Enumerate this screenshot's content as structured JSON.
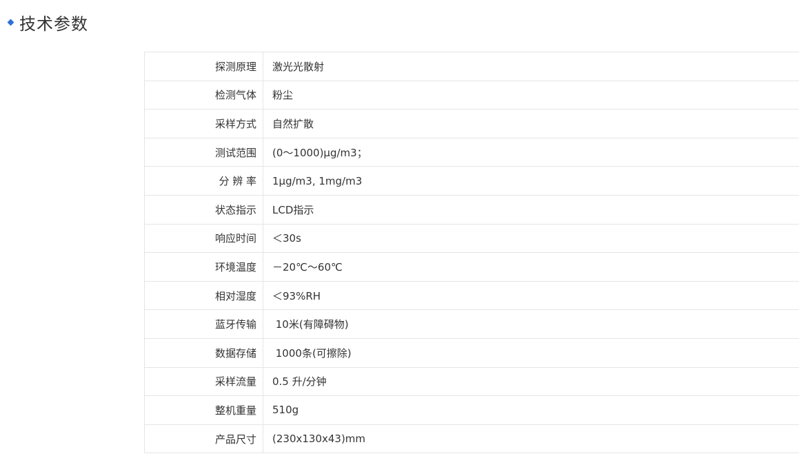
{
  "section": {
    "title": "技术参数"
  },
  "specs": [
    {
      "label": "探测原理",
      "value": "激光光散射"
    },
    {
      "label": "检测气体",
      "value": "粉尘"
    },
    {
      "label": "采样方式",
      "value": "自然扩散"
    },
    {
      "label": "测试范围",
      "value": "(0～1000)μg/m3；"
    },
    {
      "label": "分 辨 率",
      "value": "1μg/m3, 1mg/m3"
    },
    {
      "label": "状态指示",
      "value": "LCD指示"
    },
    {
      "label": "响应时间",
      "value": "＜30s"
    },
    {
      "label": "环境温度",
      "value": "－20℃～60℃"
    },
    {
      "label": "相对湿度",
      "value": "＜93%RH"
    },
    {
      "label": "蓝牙传输",
      "value": " 10米(有障碍物)"
    },
    {
      "label": "数据存储",
      "value": " 1000条(可擦除)"
    },
    {
      "label": "采样流量",
      "value": "0.5 升/分钟"
    },
    {
      "label": "整机重量",
      "value": "510g"
    },
    {
      "label": "产品尺寸",
      "value": "(230x130x43)mm"
    }
  ],
  "colors": {
    "accent": "#2f6fd6",
    "border": "#e5e5e5",
    "text": "#333333"
  }
}
